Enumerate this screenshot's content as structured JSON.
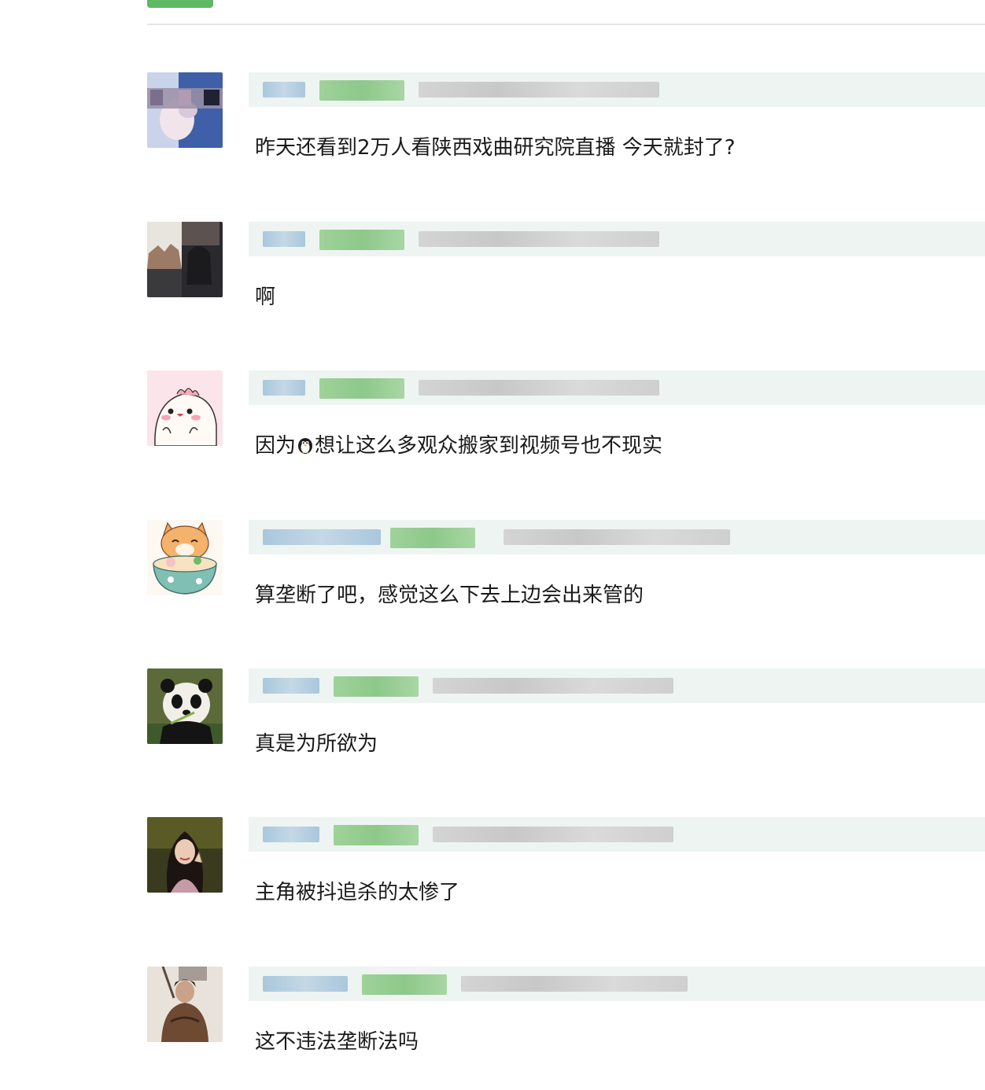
{
  "tabs": {
    "active_color": "#5fb864"
  },
  "comments": [
    {
      "text": "昨天还看到2万人看陕西戏曲研究院直播 今天就封了?",
      "avatar": "blurred-person-avatar"
    },
    {
      "text": "啊",
      "avatar": "person-window-avatar"
    },
    {
      "text_before_icon": "因为",
      "icon": "penguin-icon",
      "text_after_icon": "想让这么多观众搬家到视频号也不现实",
      "avatar": "cute-dino-avatar"
    },
    {
      "text": "算垄断了吧，感觉这么下去上边会出来管的",
      "avatar": "cat-noodle-avatar"
    },
    {
      "text": "真是为所欲为",
      "avatar": "panda-avatar"
    },
    {
      "text": "主角被抖追杀的太惨了",
      "avatar": "woman-portrait-avatar"
    },
    {
      "text": "这不违法垄断法吗",
      "avatar": "warrior-avatar"
    }
  ]
}
